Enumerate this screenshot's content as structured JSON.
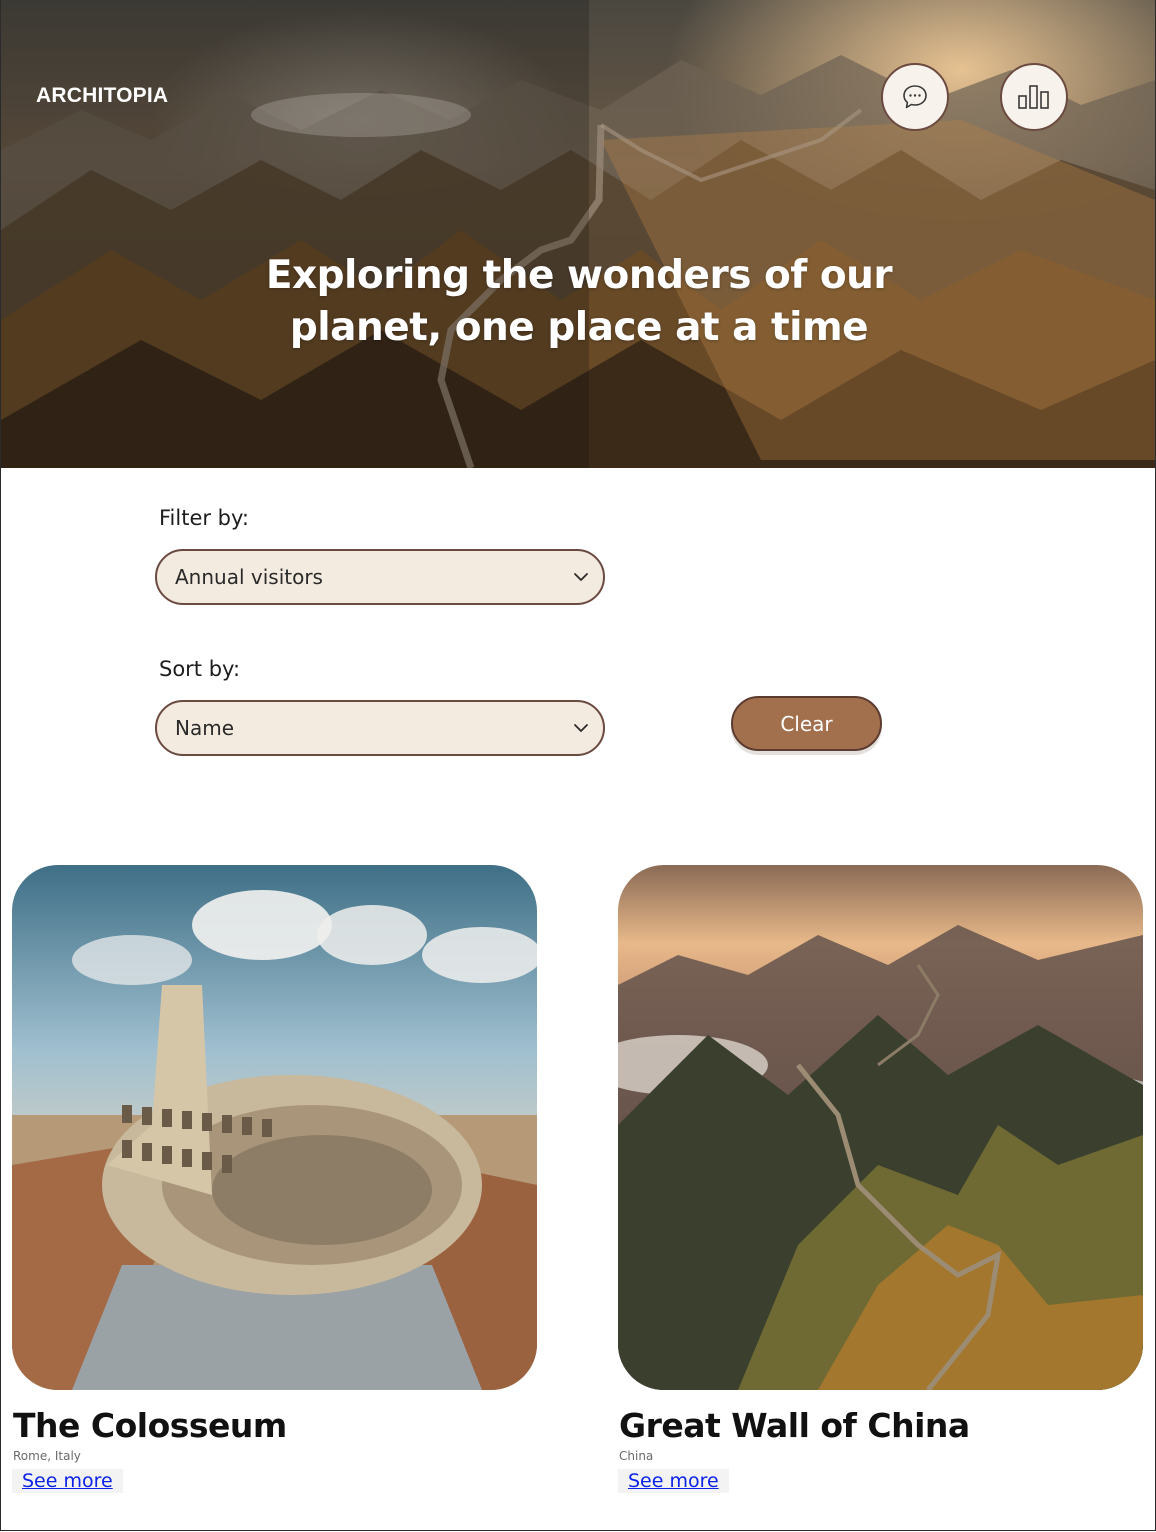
{
  "header": {
    "brand": "ARCHITOPIA",
    "headline": "Exploring the wonders of our planet, one place at a time",
    "icons": [
      "chat-bubble-icon",
      "bar-chart-icon"
    ]
  },
  "filters": {
    "filter_label": "Filter by:",
    "filter_value": "Annual visitors",
    "sort_label": "Sort by:",
    "sort_value": "Name",
    "clear_label": "Clear"
  },
  "places": [
    {
      "name": "The Colosseum",
      "location": "Rome, Italy",
      "link": "See more"
    },
    {
      "name": "Great Wall of China",
      "location": "China",
      "link": "See more"
    }
  ],
  "colors": {
    "accent": "#a3704e",
    "select_bg": "#f4ebe0",
    "border": "#6b4a40",
    "link": "#0b23e6"
  }
}
